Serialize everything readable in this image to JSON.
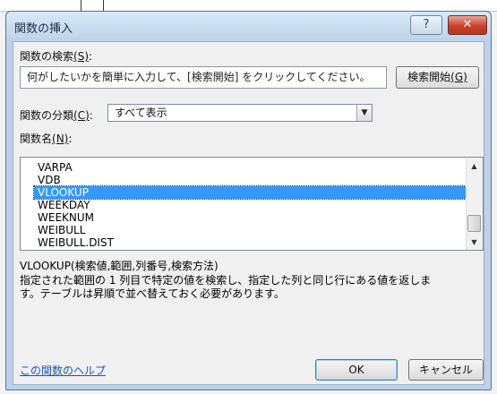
{
  "dialog": {
    "title": "関数の挿入"
  },
  "titlebar": {
    "help_glyph": "?",
    "close_glyph": "✕"
  },
  "search": {
    "label": "関数の検索",
    "label_hotkey": "(S)",
    "label_colon": ":",
    "input_value": "何がしたいかを簡単に入力して、[検索開始] をクリックしてください。",
    "button_label": "検索開始",
    "button_hotkey": "(G)"
  },
  "category": {
    "label": "関数の分類",
    "label_hotkey": "(C)",
    "label_colon": ":",
    "selected": "すべて表示"
  },
  "function_list": {
    "label": "関数名",
    "label_hotkey": "(N)",
    "label_colon": ":",
    "items": [
      "VARPA",
      "VDB",
      "VLOOKUP",
      "WEEKDAY",
      "WEEKNUM",
      "WEIBULL",
      "WEIBULL.DIST"
    ],
    "selected": "VLOOKUP"
  },
  "selected_function": {
    "syntax": "VLOOKUP(検索値,範囲,列番号,検索方法)",
    "description_line1": "指定された範囲の 1 列目で特定の値を検索し、指定した列と同じ行にある値を返しま",
    "description_line2": "す。テーブルは昇順で並べ替えておく必要があります。"
  },
  "footer": {
    "help_link": "この関数のヘルプ",
    "ok_label": "OK",
    "cancel_label": "キャンセル"
  },
  "colors": {
    "selection": "#3399ff",
    "link": "#1a55c4",
    "close_button": "#c7422d"
  },
  "icons": {
    "help": "question-icon",
    "close": "close-icon",
    "dropdown": "chevron-down-icon"
  }
}
